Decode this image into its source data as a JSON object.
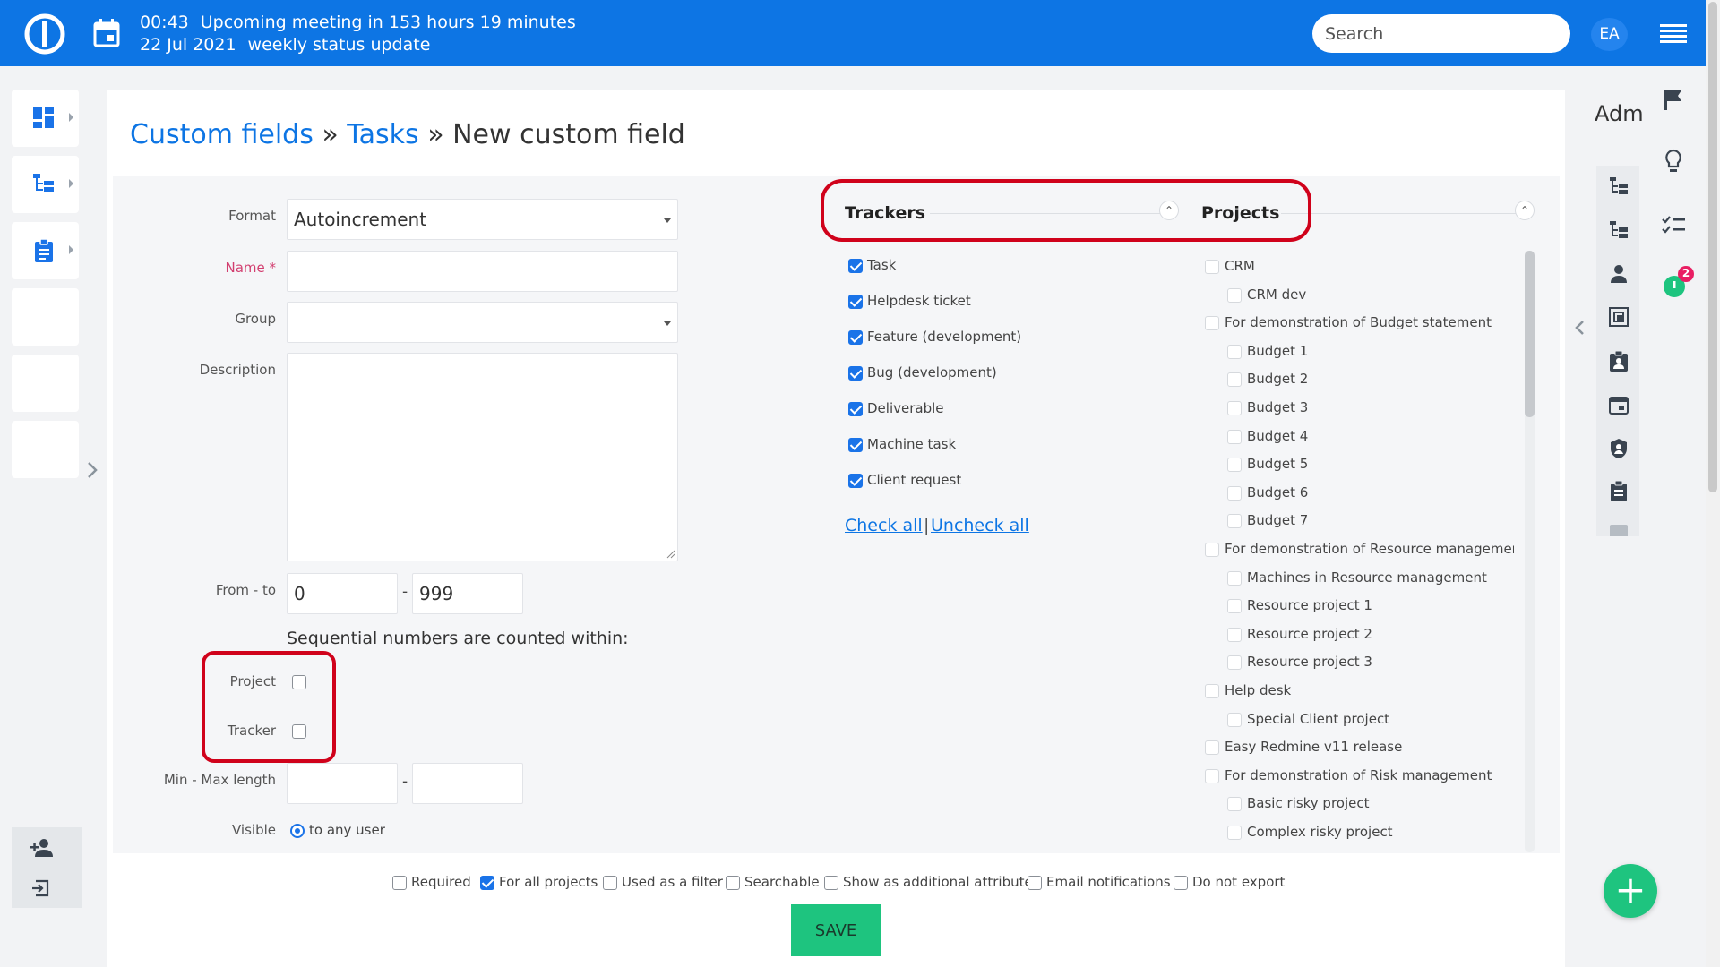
{
  "topbar": {
    "meeting_time": "00:43",
    "meeting_text": "Upcoming meeting in 153 hours 19 minutes",
    "meeting_date": "22 Jul 2021",
    "meeting_title": "weekly status update",
    "search_placeholder": "Search",
    "user_initials": "EA"
  },
  "breadcrumb": {
    "part1": "Custom fields",
    "sep1": " » ",
    "part2": "Tasks",
    "sep2": " » ",
    "current": "New custom field"
  },
  "form": {
    "format_label": "Format",
    "format_value": "Autoincrement",
    "name_label": "Name *",
    "name_value": "",
    "group_label": "Group",
    "group_value": "",
    "description_label": "Description",
    "description_value": "",
    "fromto_label": "From - to",
    "from_value": "0",
    "to_value": "999",
    "range_sep": "-",
    "sequential_text": "Sequential numbers are counted within:",
    "project_label": "Project",
    "tracker_label": "Tracker",
    "minmax_label": "Min - Max length",
    "min_value": "",
    "max_value": "",
    "minmax_sep": "-",
    "visible_label": "Visible",
    "visible_option": "to any user"
  },
  "trackers": {
    "heading": "Trackers",
    "collapse_glyph": "⌃",
    "items": [
      {
        "label": "Task",
        "checked": true
      },
      {
        "label": "Helpdesk ticket",
        "checked": true
      },
      {
        "label": "Feature (development)",
        "checked": true
      },
      {
        "label": "Bug (development)",
        "checked": true
      },
      {
        "label": "Deliverable",
        "checked": true
      },
      {
        "label": "Machine task",
        "checked": true
      },
      {
        "label": "Client request",
        "checked": true
      }
    ],
    "check_all": "Check all",
    "link_sep": "|",
    "uncheck_all": "Uncheck all"
  },
  "projects": {
    "heading": "Projects",
    "collapse_glyph": "⌃",
    "items": [
      {
        "label": "CRM",
        "level": 0
      },
      {
        "label": "CRM dev",
        "level": 1
      },
      {
        "label": "For demonstration of Budget statement",
        "level": 0
      },
      {
        "label": "Budget 1",
        "level": 1
      },
      {
        "label": "Budget 2",
        "level": 1
      },
      {
        "label": "Budget 3",
        "level": 1
      },
      {
        "label": "Budget 4",
        "level": 1
      },
      {
        "label": "Budget 5",
        "level": 1
      },
      {
        "label": "Budget 6",
        "level": 1
      },
      {
        "label": "Budget 7",
        "level": 1
      },
      {
        "label": "For demonstration of Resource management",
        "level": 0
      },
      {
        "label": "Machines in Resource management",
        "level": 1
      },
      {
        "label": "Resource project 1",
        "level": 1
      },
      {
        "label": "Resource project 2",
        "level": 1
      },
      {
        "label": "Resource project 3",
        "level": 1
      },
      {
        "label": "Help desk",
        "level": 0
      },
      {
        "label": "Special Client project",
        "level": 1
      },
      {
        "label": "Easy Redmine v11 release",
        "level": 0
      },
      {
        "label": "For demonstration of Risk management",
        "level": 0
      },
      {
        "label": "Basic risky project",
        "level": 1
      },
      {
        "label": "Complex risky project",
        "level": 1
      }
    ]
  },
  "options": {
    "required": "Required",
    "for_all_projects": "For all projects",
    "used_as_filter": "Used as a filter",
    "searchable": "Searchable",
    "show_as_additional": "Show as additional attribute",
    "email_notifications": "Email notifications",
    "do_not_export": "Do not export",
    "required_checked": false,
    "for_all_projects_checked": true
  },
  "save_label": "SAVE",
  "right_panel": {
    "title": "Adm",
    "timer_badge": "2",
    "collapse_glyph": "‹"
  },
  "fab_glyph": "+",
  "colors": {
    "topbar": "#0d75e4",
    "accent_link": "#0d75e4",
    "save_button": "#1ec47f",
    "highlight_outline": "#d0021b",
    "required_label": "#d23e6f"
  }
}
